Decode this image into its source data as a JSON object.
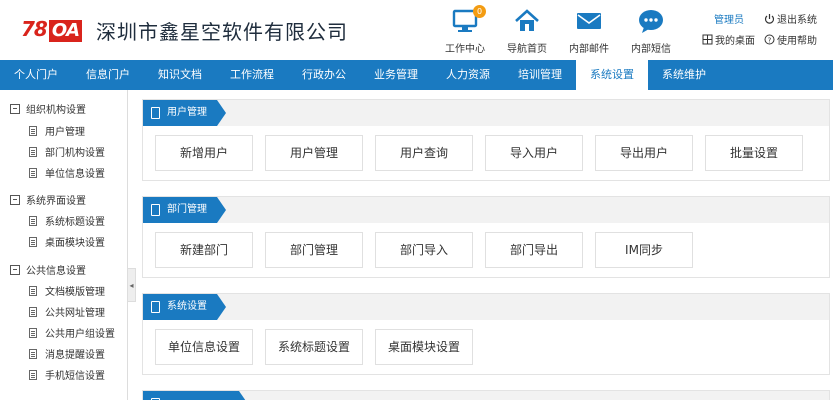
{
  "header": {
    "logo_text": "78",
    "logo_oa": "OA",
    "company": "深圳市鑫星空软件有限公司",
    "nav": [
      {
        "label": "工作中心",
        "icon": "monitor-icon",
        "badge": "0"
      },
      {
        "label": "导航首页",
        "icon": "home-icon"
      },
      {
        "label": "内部邮件",
        "icon": "mail-icon"
      },
      {
        "label": "内部短信",
        "icon": "chat-icon"
      }
    ],
    "user": "管理员",
    "logout": "退出系统",
    "my_desktop": "我的桌面",
    "help": "使用帮助"
  },
  "mainnav": [
    "个人门户",
    "信息门户",
    "知识文档",
    "工作流程",
    "行政办公",
    "业务管理",
    "人力资源",
    "培训管理",
    "系统设置",
    "系统维护"
  ],
  "mainnav_active": "系统设置",
  "colors": {
    "primary": "#1a7ac1",
    "logo_red": "#d9241c",
    "badge": "#f39c12"
  },
  "sidebar": {
    "groups": [
      {
        "label": "组织机构设置",
        "items": [
          "用户管理",
          "部门机构设置",
          "单位信息设置"
        ]
      },
      {
        "label": "系统界面设置",
        "items": [
          "系统标题设置",
          "桌面模块设置"
        ]
      },
      {
        "label": "公共信息设置",
        "items": [
          "文档模版管理",
          "公共网址管理",
          "公共用户组设置",
          "消息提醒设置",
          "手机短信设置"
        ]
      }
    ],
    "collapse_glyph": "◂"
  },
  "sections": [
    {
      "title": "用户管理",
      "buttons": [
        "新增用户",
        "用户管理",
        "用户查询",
        "导入用户",
        "导出用户",
        "批量设置"
      ]
    },
    {
      "title": "部门管理",
      "buttons": [
        "新建部门",
        "部门管理",
        "部门导入",
        "部门导出",
        "IM同步"
      ]
    },
    {
      "title": "系统设置",
      "buttons": [
        "单位信息设置",
        "系统标题设置",
        "桌面模块设置"
      ]
    }
  ]
}
